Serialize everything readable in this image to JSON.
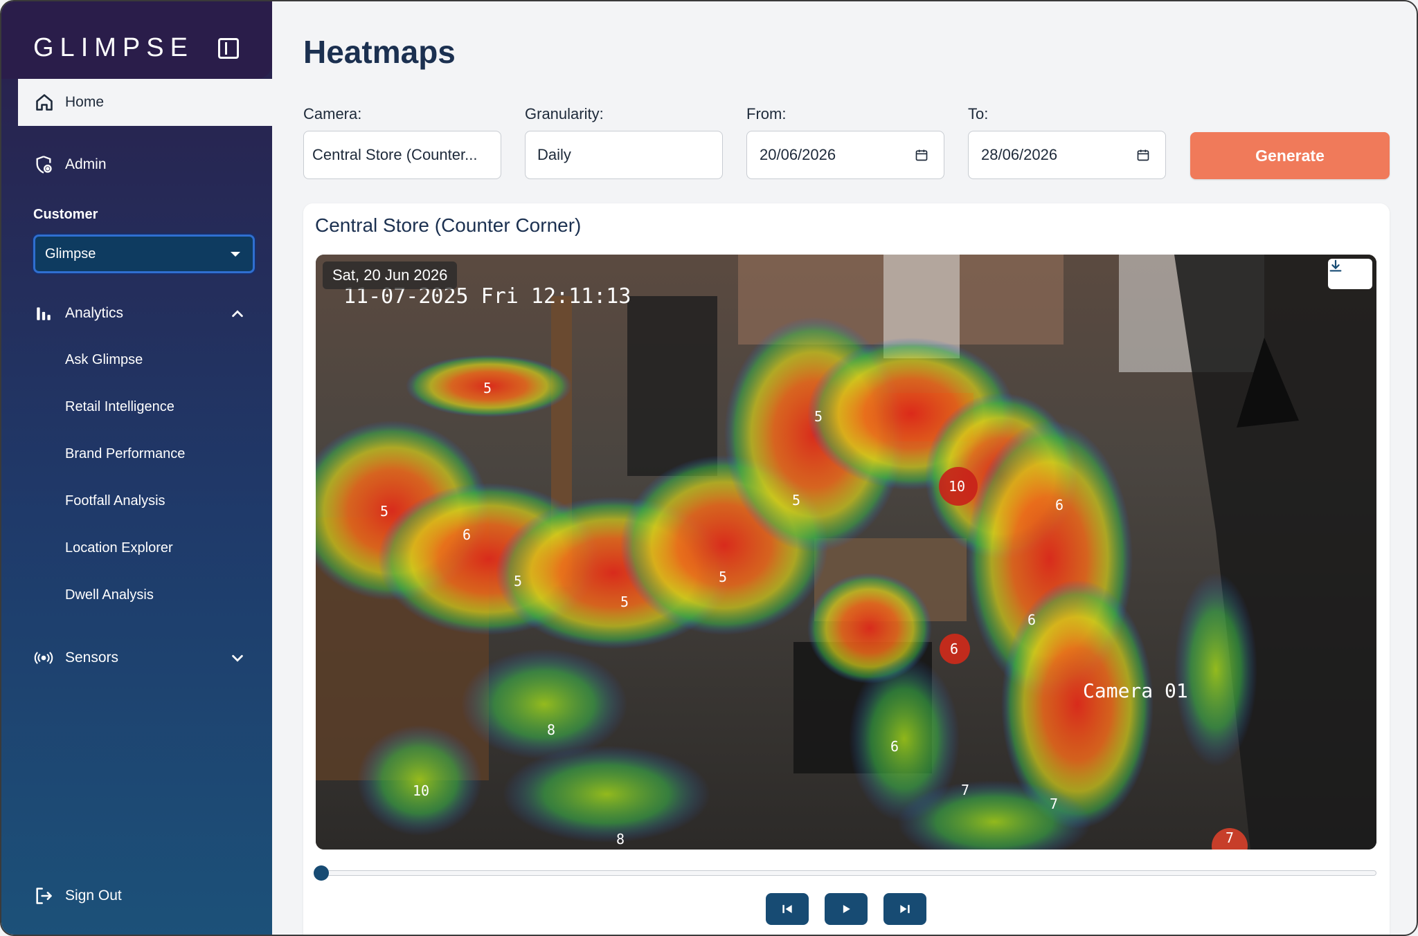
{
  "app": {
    "logo": "GLIMPSE"
  },
  "sidebar": {
    "home_label": "Home",
    "admin_label": "Admin",
    "customer_section_label": "Customer",
    "customer_selected": "Glimpse",
    "analytics_label": "Analytics",
    "analytics_items": [
      "Ask Glimpse",
      "Retail Intelligence",
      "Brand Performance",
      "Footfall Analysis",
      "Location Explorer",
      "Dwell Analysis"
    ],
    "sensors_label": "Sensors",
    "sign_out_label": "Sign Out"
  },
  "header": {
    "title": "Heatmaps"
  },
  "filters": {
    "camera_label": "Camera:",
    "camera_value": "Central Store (Counter...",
    "granularity_label": "Granularity:",
    "granularity_value": "Daily",
    "from_label": "From:",
    "from_value": "20/06/2026",
    "to_label": "To:",
    "to_value": "28/06/2026",
    "generate_label": "Generate"
  },
  "card": {
    "title": "Central Store (Counter Corner)",
    "date_chip": "Sat, 20 Jun 2026",
    "camera_timestamp": "11-07-2025 Fri 12:11:13",
    "camera_name": "Camera 01",
    "dwell_labels": [
      "5",
      "5",
      "5",
      "6",
      "5",
      "5",
      "5",
      "5",
      "10",
      "6",
      "6",
      "6",
      "6",
      "8",
      "10",
      "7",
      "7",
      "8",
      "7"
    ]
  },
  "timeline": {
    "position": 0
  },
  "colors": {
    "accent": "#f07a5a",
    "primary": "#174b73",
    "title": "#1b3050"
  }
}
